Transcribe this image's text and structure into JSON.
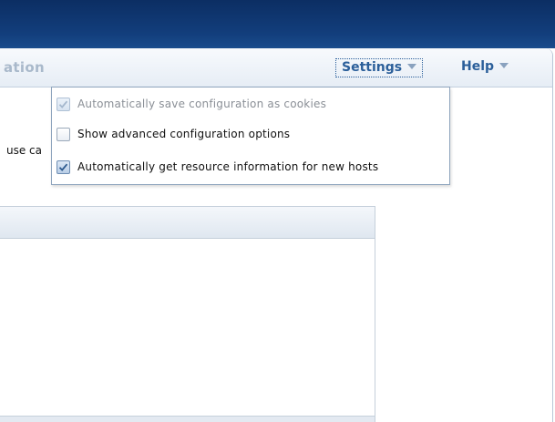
{
  "header": {
    "title_partial": "ation"
  },
  "menus": {
    "settings_label": "Settings",
    "help_label": "Help"
  },
  "body": {
    "partial_text": "use ca"
  },
  "settings_dropdown": {
    "items": [
      {
        "label": "Automatically save configuration as cookies",
        "checked": true,
        "disabled": true
      },
      {
        "label": "Show advanced configuration options",
        "checked": false,
        "disabled": false
      },
      {
        "label": "Automatically get resource information for new hosts",
        "checked": true,
        "disabled": false
      }
    ]
  },
  "colors": {
    "banner": "#123e7c",
    "menu_text": "#2b5f9a",
    "header_title": "#a9b9cb"
  }
}
